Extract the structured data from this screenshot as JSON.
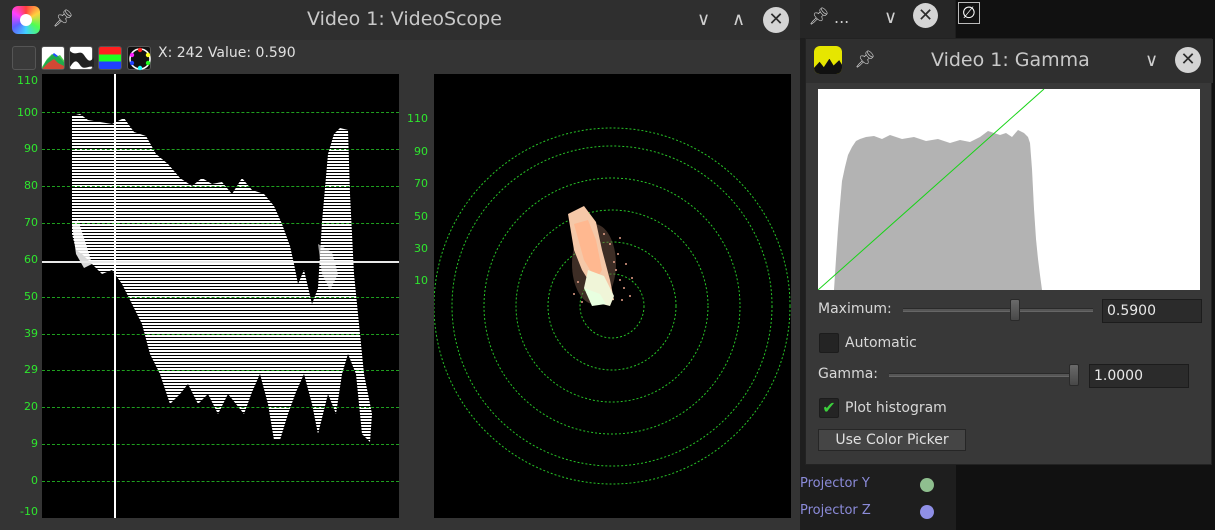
{
  "videoscope": {
    "title": "Video 1: VideoScope",
    "readout": "X: 242 Value: 0.590",
    "toolbar": {
      "icons": [
        "blank-icon",
        "histogram-icon",
        "waveform-icon",
        "rgb-parade-icon",
        "vectorscope-icon"
      ]
    },
    "waveform_ticks": [
      "110",
      "100",
      "90",
      "80",
      "70",
      "60",
      "50",
      "39",
      "29",
      "20",
      "9",
      "0",
      "-10"
    ],
    "vector_ticks": [
      "110",
      "90",
      "70",
      "50",
      "30",
      "10"
    ],
    "colors": {
      "grid": "#1fa11f",
      "tick": "#2ee62e",
      "background": "#000000"
    }
  },
  "background_window": {
    "title_ellipsis": "...",
    "projector_y": "Projector Y",
    "projector_z": "Projector Z",
    "dot_y_color": "#8fbf8f",
    "dot_z_color": "#8f8fe6"
  },
  "gamma": {
    "title": "Video 1: Gamma",
    "maximum_label": "Maximum:",
    "maximum_value": "0.5900",
    "maximum_slider_fraction": 0.59,
    "automatic_label": "Automatic",
    "automatic_checked": false,
    "gamma_label": "Gamma:",
    "gamma_value": "1.0000",
    "gamma_slider_fraction": 1.0,
    "plot_histogram_label": "Plot histogram",
    "plot_histogram_checked": true,
    "color_picker_label": "Use Color Picker"
  }
}
